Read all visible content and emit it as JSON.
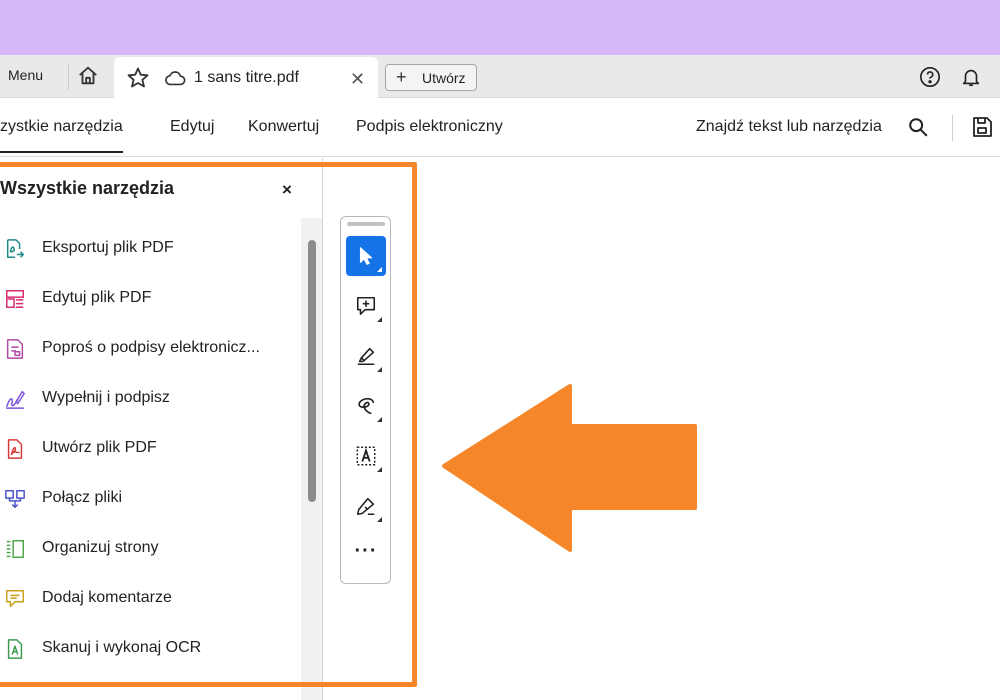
{
  "tab_bar": {
    "menu_label": "Menu",
    "doc_title": "1 sans titre.pdf",
    "tab_close": "✕",
    "create_label": "Utwórz",
    "create_plus": "+"
  },
  "menu_bar": {
    "items": [
      {
        "label": "szystkie narzędzia"
      },
      {
        "label": "Edytuj"
      },
      {
        "label": "Konwertuj"
      },
      {
        "label": "Podpis elektroniczny"
      }
    ],
    "find_label": "Znajdź tekst lub narzędzia"
  },
  "tools_panel": {
    "title": "Wszystkie narzędzia",
    "close": "×",
    "items": [
      {
        "label": "Eksportuj plik PDF",
        "icon": "export-pdf-icon",
        "color": "#1f8a8a"
      },
      {
        "label": "Edytuj plik PDF",
        "icon": "edit-pdf-icon",
        "color": "#d6296f"
      },
      {
        "label": "Poproś o podpisy elektronicz...",
        "icon": "request-signatures-icon",
        "color": "#b14aa8"
      },
      {
        "label": "Wypełnij i podpisz",
        "icon": "fill-sign-icon",
        "color": "#7a54d8"
      },
      {
        "label": "Utwórz plik PDF",
        "icon": "create-pdf-icon",
        "color": "#d73a3a"
      },
      {
        "label": "Połącz pliki",
        "icon": "combine-files-icon",
        "color": "#4a52c9"
      },
      {
        "label": "Organizuj strony",
        "icon": "organize-pages-icon",
        "color": "#4fa64a"
      },
      {
        "label": "Dodaj komentarze",
        "icon": "add-comments-icon",
        "color": "#c9a11a"
      },
      {
        "label": "Skanuj i wykonaj OCR",
        "icon": "scan-ocr-icon",
        "color": "#3c9a4c"
      }
    ]
  },
  "quick_tools": {
    "items": [
      {
        "icon": "select-cursor-icon",
        "active": true
      },
      {
        "icon": "add-comment-icon",
        "active": false
      },
      {
        "icon": "highlight-pen-icon",
        "active": false
      },
      {
        "icon": "draw-freeform-icon",
        "active": false
      },
      {
        "icon": "text-box-icon",
        "active": false
      },
      {
        "icon": "fill-sign-pen-icon",
        "active": false
      }
    ],
    "more_label": "···"
  },
  "colors": {
    "accent_blue": "#1473e6",
    "annotation_orange": "#f5872a",
    "top_band": "#d6b8fb"
  }
}
